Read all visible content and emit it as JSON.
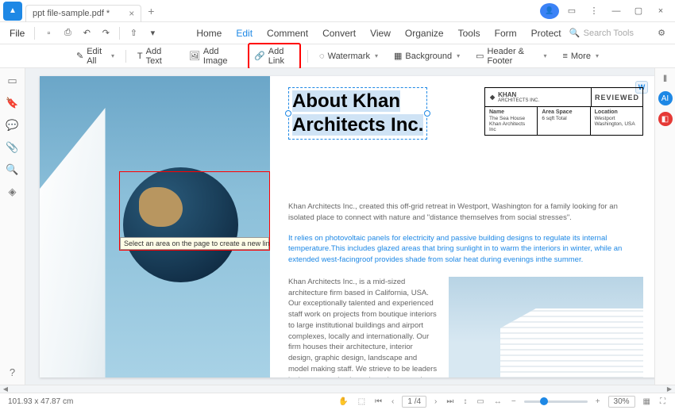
{
  "titlebar": {
    "tab_name": "ppt file-sample.pdf *"
  },
  "menubar": {
    "file": "File",
    "tabs": [
      "Home",
      "Edit",
      "Comment",
      "Convert",
      "View",
      "Organize",
      "Tools",
      "Form",
      "Protect"
    ],
    "active_tab": "Edit",
    "search_placeholder": "Search Tools"
  },
  "toolbar": {
    "edit_all": "Edit All",
    "add_text": "Add Text",
    "add_image": "Add Image",
    "add_link": "Add Link",
    "watermark": "Watermark",
    "background": "Background",
    "header_footer": "Header & Footer",
    "more": "More"
  },
  "tooltip": "Select an area on the page to create a new link",
  "doc": {
    "title_line1": "About Khan",
    "title_line2": "Architects Inc.",
    "brand": "KHAN",
    "brand_sub": "ARCHITECTS INC.",
    "reviewed": "REVIEWED",
    "meta": {
      "name_label": "Name",
      "name_val": "The Sea House Khan Architects Inc",
      "area_label": "Area Space",
      "area_val": "6 sqft Total",
      "loc_label": "Location",
      "loc_val": "Westport Washington, USA"
    },
    "p1": "Khan Architects Inc., created this off-grid retreat in Westport, Washington for a family looking for an isolated place to connect with nature and \"distance themselves from social stresses\".",
    "p2": "It relies on photovoltaic panels for electricity and passive building designs to regulate its internal temperature.This includes glazed areas that bring sunlight in to warm the interiors in winter, while an extended west-facingroof provides shade from solar heat during evenings inthe summer.",
    "p3": "Khan Architects Inc., is a mid-sized architecture firm based in California, USA. Our exceptionally talented and experienced staff work on projects from boutique interiors to large institutional buildings and airport complexes, locally and internationally. Our firm houses their architecture, interior design, graphic design, landscape and model making staff. We strieve to be leaders in the community through work, research and personal choices."
  },
  "status": {
    "coords": "101.93 x 47.87 cm",
    "page_current": "1",
    "page_total": "4",
    "zoom": "30%"
  }
}
